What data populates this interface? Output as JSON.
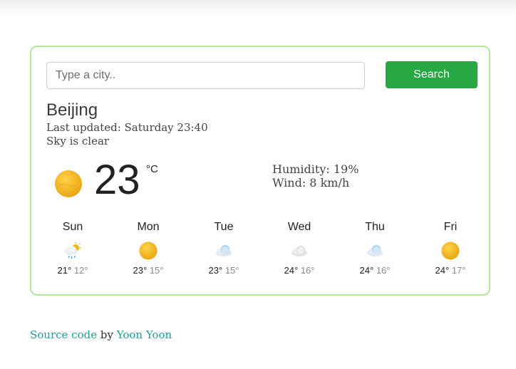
{
  "search": {
    "placeholder": "Type a city..",
    "button_label": "Search"
  },
  "current": {
    "city": "Beijing",
    "last_updated": "Last updated: Saturday 23:40",
    "description": "Sky is clear",
    "icon": "sun-icon",
    "temperature": "23",
    "unit": "°C",
    "humidity": "Humidity: 19%",
    "wind": "Wind: 8 km/h"
  },
  "forecast": [
    {
      "day": "Sun",
      "icon": "rain-cloud-sun-icon",
      "high": "21°",
      "low": "12°"
    },
    {
      "day": "Mon",
      "icon": "sun-icon",
      "high": "23°",
      "low": "15°"
    },
    {
      "day": "Tue",
      "icon": "cloud-icon",
      "high": "23°",
      "low": "15°"
    },
    {
      "day": "Wed",
      "icon": "cloud-gray-icon",
      "high": "24°",
      "low": "16°"
    },
    {
      "day": "Thu",
      "icon": "cloud-icon",
      "high": "24°",
      "low": "16°"
    },
    {
      "day": "Fri",
      "icon": "sun-icon",
      "high": "24°",
      "low": "17°"
    }
  ],
  "footer": {
    "source_link": "Source code",
    "by_text": " by ",
    "author_link": "Yoon Yoon"
  },
  "colors": {
    "card_border": "#b4e6a0",
    "button": "#28a745",
    "link": "#1f9e94",
    "sun": "#f1b51c"
  }
}
